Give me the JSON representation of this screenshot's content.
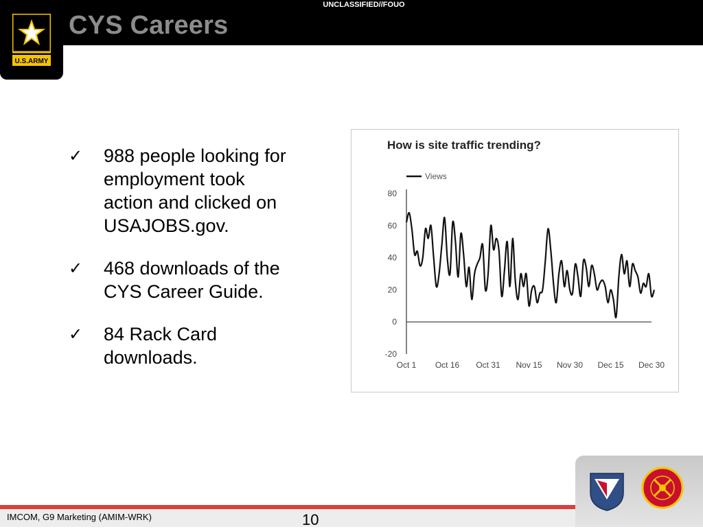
{
  "header": {
    "title": "CYS Careers",
    "classification": "UNCLASSIFIED//FOUO",
    "logo_text": "U.S.ARMY"
  },
  "bullets": [
    {
      "check": "✓",
      "text_lines": [
        "988 people looking for",
        "employment took",
        "action and clicked on",
        "USAJOBS.gov."
      ]
    },
    {
      "check": "✓",
      "text_lines": [
        "468 downloads of the",
        "CYS Career Guide."
      ]
    },
    {
      "check": "✓",
      "text_lines": [
        "84 Rack Card",
        "downloads."
      ]
    }
  ],
  "footer": {
    "org": "IMCOM, G9 Marketing (AMIM-WRK)",
    "page": "10"
  },
  "colors": {
    "title_gray": "#8c8c8c",
    "footer_red": "#d8403a",
    "army_gold": "#f5c400"
  },
  "chart_data": {
    "type": "line",
    "title": "How is site traffic trending?",
    "xlabel": "",
    "ylabel": "",
    "ylim": [
      -20,
      80
    ],
    "yticks": [
      80,
      60,
      40,
      20,
      0,
      -20
    ],
    "xtick_labels": [
      "Oct 1",
      "Oct 16",
      "Oct 31",
      "Nov 15",
      "Nov 30",
      "Dec 15",
      "Dec 30"
    ],
    "xtick_days": [
      0,
      15,
      30,
      45,
      60,
      75,
      90
    ],
    "legend": "top-left",
    "grid": false,
    "series": [
      {
        "name": "Views",
        "x": [
          0,
          1,
          2,
          3,
          4,
          5,
          6,
          7,
          8,
          9,
          10,
          11,
          12,
          13,
          14,
          15,
          16,
          17,
          18,
          19,
          20,
          21,
          22,
          23,
          24,
          25,
          26,
          27,
          28,
          29,
          30,
          31,
          32,
          33,
          34,
          35,
          36,
          37,
          38,
          39,
          40,
          41,
          42,
          43,
          44,
          45,
          46,
          47,
          48,
          49,
          50,
          51,
          52,
          53,
          54,
          55,
          56,
          57,
          58,
          59,
          60,
          61,
          62,
          63,
          64,
          65,
          66,
          67,
          68,
          69,
          70,
          71,
          72,
          73,
          74,
          75,
          76,
          77,
          78,
          79,
          80,
          81,
          82,
          83,
          84,
          85,
          86,
          87,
          88,
          89,
          90,
          91
        ],
        "values": [
          62,
          68,
          58,
          42,
          44,
          35,
          40,
          58,
          52,
          60,
          40,
          22,
          30,
          48,
          65,
          40,
          30,
          62,
          50,
          28,
          55,
          42,
          22,
          34,
          14,
          30,
          36,
          40,
          48,
          20,
          30,
          60,
          45,
          52,
          44,
          16,
          32,
          50,
          22,
          52,
          25,
          14,
          30,
          22,
          30,
          10,
          20,
          22,
          12,
          18,
          20,
          38,
          58,
          45,
          24,
          12,
          30,
          38,
          22,
          32,
          20,
          18,
          36,
          28,
          16,
          38,
          34,
          22,
          35,
          30,
          20,
          24,
          26,
          22,
          12,
          20,
          14,
          3,
          28,
          42,
          30,
          38,
          22,
          36,
          32,
          28,
          18,
          24,
          22,
          30,
          16,
          20
        ]
      }
    ]
  }
}
